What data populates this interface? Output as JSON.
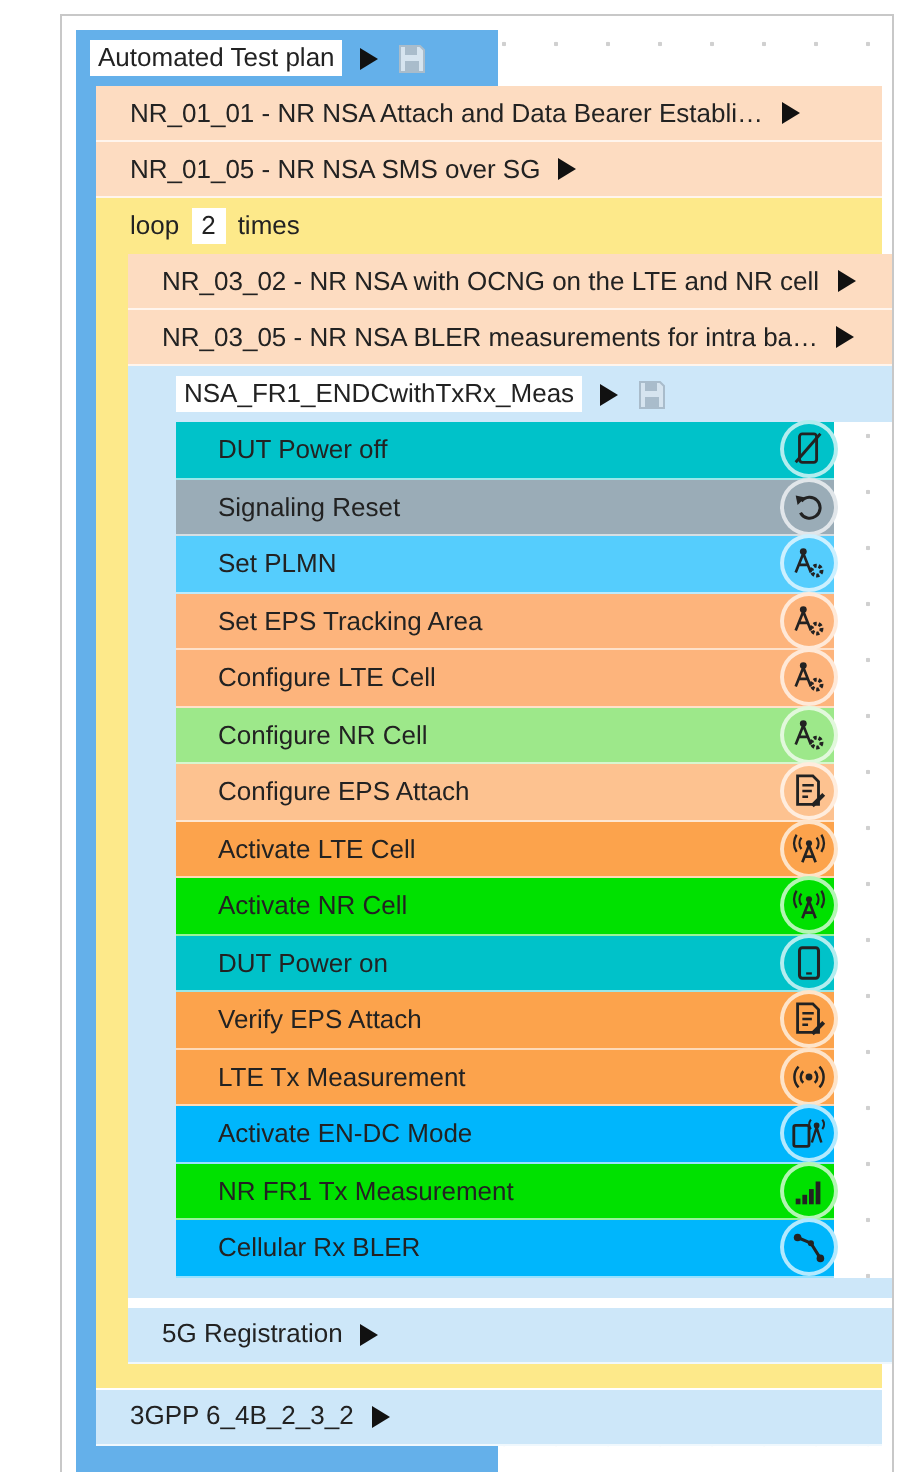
{
  "plan": {
    "title": "Automated Test plan",
    "items": [
      {
        "kind": "test",
        "label": "NR_01_01 - NR NSA Attach and Data Bearer Establi…"
      },
      {
        "kind": "test",
        "label": "NR_01_05 - NR NSA SMS over SG"
      },
      {
        "kind": "loop",
        "prefix": "loop",
        "count": "2",
        "suffix": "times",
        "items": [
          {
            "kind": "test",
            "label": "NR_03_02 - NR NSA with OCNG on the LTE and NR cell"
          },
          {
            "kind": "test",
            "label": "NR_03_05 - NR NSA BLER measurements for intra ba…"
          },
          {
            "kind": "sequence",
            "title": "NSA_FR1_ENDCwithTxRx_Meas",
            "steps": [
              {
                "label": "DUT Power off",
                "color": "#00c2c9",
                "kind": "phoneoff"
              },
              {
                "label": "Signaling Reset",
                "color": "#9aacb7",
                "kind": "reset"
              },
              {
                "label": "Set PLMN",
                "color": "#55cdfd",
                "kind": "config"
              },
              {
                "label": "Set EPS Tracking Area",
                "color": "#fdb47c",
                "kind": "config"
              },
              {
                "label": "Configure LTE Cell",
                "color": "#fdb47c",
                "kind": "config"
              },
              {
                "label": "Configure NR Cell",
                "color": "#9de88a",
                "kind": "config"
              },
              {
                "label": "Configure EPS Attach",
                "color": "#fdc290",
                "kind": "attach"
              },
              {
                "label": "Activate LTE Cell",
                "color": "#fca34c",
                "kind": "tower"
              },
              {
                "label": "Activate NR Cell",
                "color": "#00e100",
                "kind": "tower"
              },
              {
                "label": "DUT Power on",
                "color": "#00c2c9",
                "kind": "phone"
              },
              {
                "label": "Verify EPS Attach",
                "color": "#fca34c",
                "kind": "attach"
              },
              {
                "label": "LTE Tx Measurement",
                "color": "#fca34c",
                "kind": "broadcast"
              },
              {
                "label": "Activate EN-DC Mode",
                "color": "#00b6fc",
                "kind": "mode"
              },
              {
                "label": "NR FR1 Tx Measurement",
                "color": "#00e100",
                "kind": "bars"
              },
              {
                "label": "Cellular Rx BLER",
                "color": "#00b6fc",
                "kind": "route"
              }
            ]
          },
          {
            "kind": "group",
            "label": "5G Registration"
          }
        ]
      },
      {
        "kind": "group",
        "label": "3GPP 6_4B_2_3_2"
      }
    ]
  }
}
